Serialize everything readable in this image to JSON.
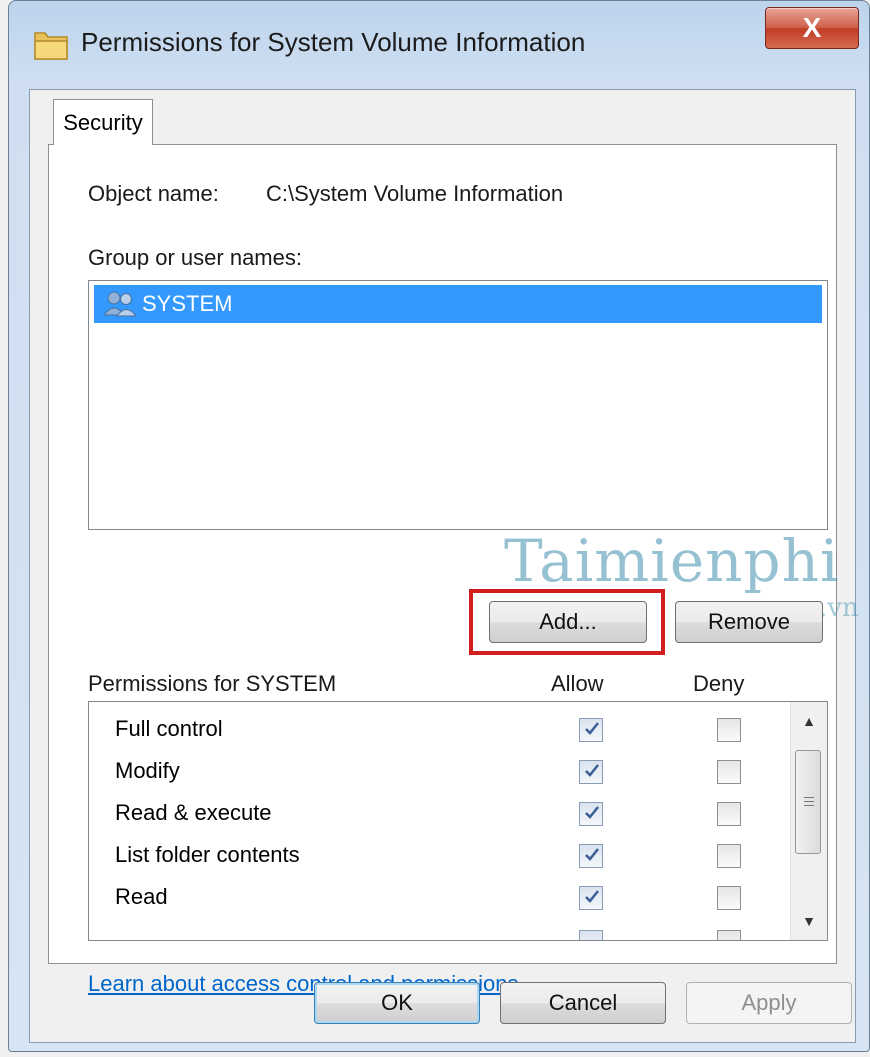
{
  "window": {
    "title": "Permissions for System Volume Information",
    "close_label": "X"
  },
  "tabs": [
    {
      "label": "Security"
    }
  ],
  "object_name": {
    "label": "Object name:",
    "value": "C:\\System Volume Information"
  },
  "group": {
    "label": "Group or user names:",
    "items": [
      {
        "name": "SYSTEM",
        "selected": true,
        "icon": "users-icon"
      }
    ]
  },
  "buttons": {
    "add": "Add...",
    "remove": "Remove",
    "ok": "OK",
    "cancel": "Cancel",
    "apply": "Apply"
  },
  "permissions": {
    "label": "Permissions for SYSTEM",
    "allow_header": "Allow",
    "deny_header": "Deny",
    "rows": [
      {
        "name": "Full control",
        "allow": true,
        "deny": false
      },
      {
        "name": "Modify",
        "allow": true,
        "deny": false
      },
      {
        "name": "Read & execute",
        "allow": true,
        "deny": false
      },
      {
        "name": "List folder contents",
        "allow": true,
        "deny": false
      },
      {
        "name": "Read",
        "allow": true,
        "deny": false
      }
    ]
  },
  "link": "Learn about access control and permissions",
  "watermark": {
    "main": "Taimienphi",
    "sub": ".vn"
  },
  "colors": {
    "selection": "#3399ff",
    "highlight_box": "#d11f1f",
    "link": "#0066cc"
  }
}
